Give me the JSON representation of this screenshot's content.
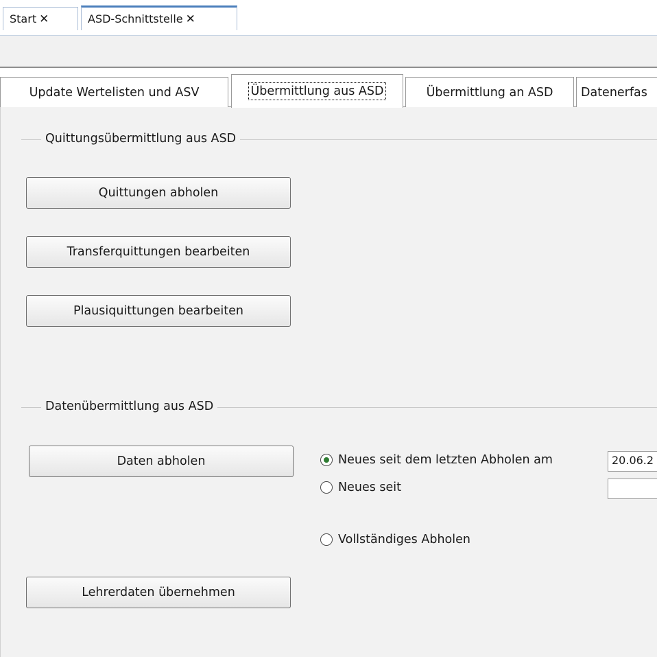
{
  "doc_tabs": [
    {
      "label": "Start",
      "close": "✕"
    },
    {
      "label": "ASD-Schnittstelle",
      "close": "✕"
    }
  ],
  "content_tabs": [
    {
      "label": "Update Wertelisten und ASV"
    },
    {
      "label": "Übermittlung aus ASD"
    },
    {
      "label": "Übermittlung an ASD"
    },
    {
      "label": "Datenerfas"
    }
  ],
  "quittung_group": {
    "title": "Quittungsübermittlung aus ASD",
    "buttons": [
      "Quittungen abholen",
      "Transferquittungen bearbeiten",
      "Plausiquittungen bearbeiten"
    ]
  },
  "daten_group": {
    "title": "Datenübermittlung aus ASD",
    "daten_button": "Daten abholen",
    "radios": [
      {
        "label": "Neues seit dem letzten Abholen am",
        "checked": true
      },
      {
        "label": "Neues seit",
        "checked": false
      },
      {
        "label": "Vollständiges Abholen",
        "checked": false
      }
    ],
    "last_fetch_value": "20.06.2",
    "since_value": "",
    "lehrer_button": "Lehrerdaten übernehmen"
  }
}
